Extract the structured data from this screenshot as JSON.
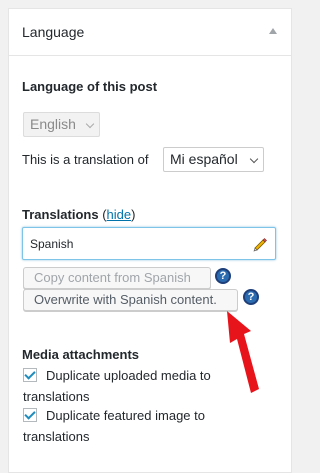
{
  "panel": {
    "title": "Language",
    "collapse_icon": "triangle-up-icon"
  },
  "post_language": {
    "heading": "Language of this post",
    "selected": "English"
  },
  "translation_of": {
    "label": "This is a translation of",
    "selected": "Mi español"
  },
  "translations": {
    "heading": "Translations",
    "hide_link": "hide",
    "open_paren": "(",
    "close_paren": ")",
    "input_value": "Spanish",
    "edit_icon": "pencil-icon"
  },
  "buttons": {
    "copy_content": "Copy content from Spanish",
    "overwrite": "Overwrite with Spanish content."
  },
  "help_icon_glyph": "?",
  "media": {
    "heading": "Media attachments",
    "duplicate_uploaded_line1": "Duplicate uploaded media to",
    "duplicate_uploaded_line2": "translations",
    "duplicate_featured_line1": "Duplicate featured image to",
    "duplicate_featured_line2": "translations",
    "duplicate_uploaded_checked": true,
    "duplicate_featured_checked": true
  },
  "colors": {
    "link": "#0073aa",
    "annotation_arrow": "#e8141c",
    "help_icon": "#2b6cb0",
    "checkmark": "#1e8cbe"
  }
}
